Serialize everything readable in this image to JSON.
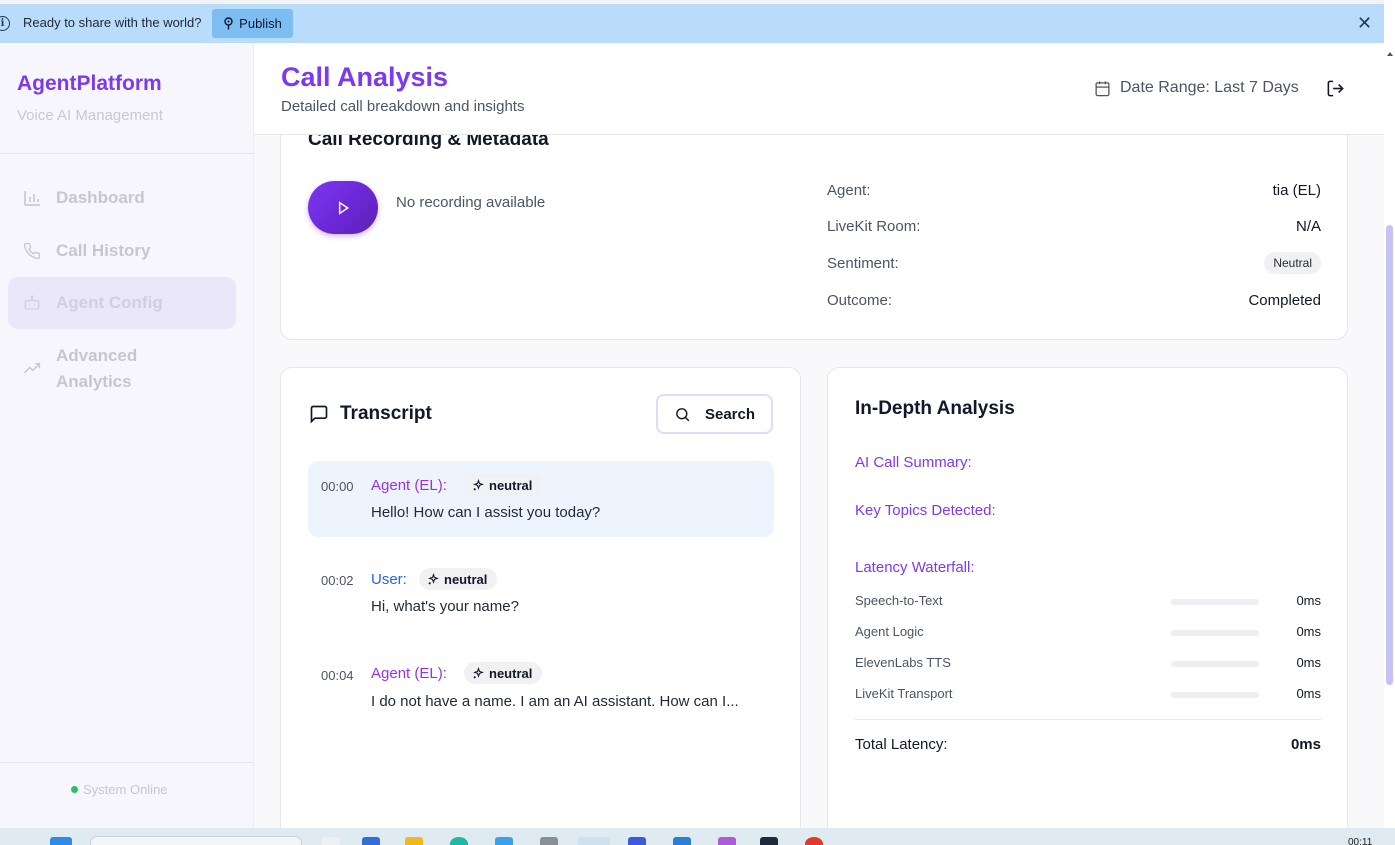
{
  "banner": {
    "message": "Ready to share with the world?",
    "publish_label": "Publish"
  },
  "sidebar": {
    "brand": "AgentPlatform",
    "brand_sub": "Voice AI Management",
    "items": [
      {
        "label": "Dashboard",
        "icon": "bar-chart-icon"
      },
      {
        "label": "Call History",
        "icon": "phone-icon"
      },
      {
        "label": "Agent Config",
        "icon": "bot-icon",
        "active": true
      },
      {
        "label": "Advanced Analytics",
        "icon": "trending-up-icon"
      }
    ],
    "status": "System Online"
  },
  "header": {
    "title": "Call Analysis",
    "subtitle": "Detailed call breakdown and insights",
    "date_range": "Date Range: Last 7 Days"
  },
  "recording": {
    "title": "Call Recording & Metadata",
    "no_recording": "No recording available",
    "meta": [
      {
        "key": "Agent:",
        "value": "tia (EL)"
      },
      {
        "key": "LiveKit Room:",
        "value": "N/A"
      },
      {
        "key": "Sentiment:",
        "value": "Neutral"
      },
      {
        "key": "Outcome:",
        "value": "Completed"
      }
    ]
  },
  "transcript": {
    "title": "Transcript",
    "search_label": "Search",
    "messages": [
      {
        "time": "00:00",
        "speaker": "Agent (EL):",
        "sentiment": "neutral",
        "text": "Hello! How can I assist you today?"
      },
      {
        "time": "00:02",
        "speaker": "User:",
        "sentiment": "neutral",
        "text": "Hi, what's your name?"
      },
      {
        "time": "00:04",
        "speaker": "Agent (EL):",
        "sentiment": "neutral",
        "text": "I do not have a name. I am an AI assistant. How can I..."
      }
    ]
  },
  "analysis": {
    "title": "In-Depth Analysis",
    "summary_label": "AI Call Summary:",
    "topics_label": "Key Topics Detected:",
    "latency_label": "Latency Waterfall:",
    "latency": [
      {
        "name": "Speech-to-Text",
        "value": "0ms"
      },
      {
        "name": "Agent Logic",
        "value": "0ms"
      },
      {
        "name": "ElevenLabs TTS",
        "value": "0ms"
      },
      {
        "name": "LiveKit Transport",
        "value": "0ms"
      }
    ],
    "total_label": "Total Latency:",
    "total_value": "0ms"
  },
  "taskbar": {
    "clock": "00:11"
  },
  "colors": {
    "accent": "#7c3aed",
    "banner": "#b9dcfb",
    "status_online": "#22c55e"
  }
}
